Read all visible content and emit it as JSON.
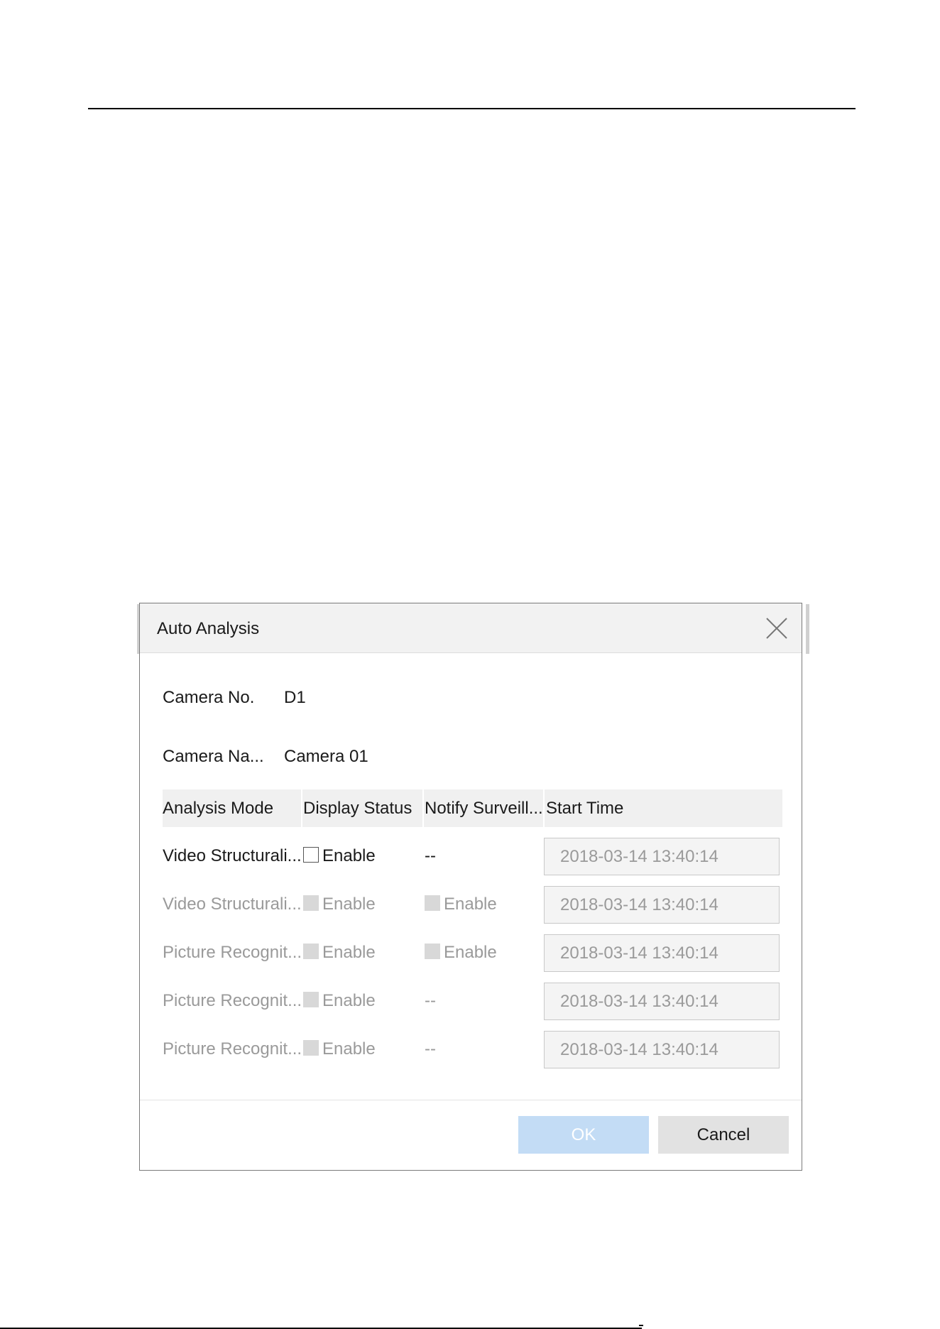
{
  "dialog": {
    "title": "Auto Analysis",
    "close_icon": "close-icon"
  },
  "fields": {
    "camera_no_label": "Camera No.",
    "camera_no_value": "D1",
    "camera_name_label": "Camera Na...",
    "camera_name_value": "Camera 01"
  },
  "table": {
    "headers": [
      "Analysis Mode",
      "Display Status",
      "Notify Surveill...",
      "Start Time"
    ],
    "rows": [
      {
        "mode": "Video Structurali...",
        "display_checked": false,
        "display_label": "Enable",
        "notify_label": "--",
        "notify_has_checkbox": false,
        "start_time": "2018-03-14 13:40:14",
        "enabled": true
      },
      {
        "mode": "Video Structurali...",
        "display_checked": false,
        "display_label": "Enable",
        "notify_label": "Enable",
        "notify_has_checkbox": true,
        "start_time": "2018-03-14 13:40:14",
        "enabled": false
      },
      {
        "mode": "Picture Recognit...",
        "display_checked": false,
        "display_label": "Enable",
        "notify_label": "Enable",
        "notify_has_checkbox": true,
        "start_time": "2018-03-14 13:40:14",
        "enabled": false
      },
      {
        "mode": "Picture Recognit...",
        "display_checked": false,
        "display_label": "Enable",
        "notify_label": "--",
        "notify_has_checkbox": false,
        "start_time": "2018-03-14 13:40:14",
        "enabled": false
      },
      {
        "mode": "Picture Recognit...",
        "display_checked": false,
        "display_label": "Enable",
        "notify_label": "--",
        "notify_has_checkbox": false,
        "start_time": "2018-03-14 13:40:14",
        "enabled": false
      }
    ]
  },
  "buttons": {
    "ok_label": "OK",
    "cancel_label": "Cancel"
  },
  "colors": {
    "ok_button_bg": "#c3dcf5",
    "cancel_button_bg": "#e2e2e2",
    "header_bg": "#f2f2f2",
    "disabled_text": "#9a9a9a"
  }
}
